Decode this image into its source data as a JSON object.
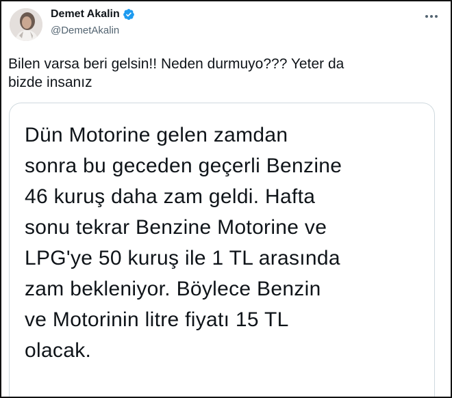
{
  "tweet": {
    "author": {
      "display_name": "Demet Akalin",
      "handle": "@DemetAkalin",
      "verified": true,
      "verified_icon": "verified-badge-icon",
      "avatar_icon": "profile-photo"
    },
    "more_icon": "more-options-icon",
    "text_line_1": "Bilen varsa beri gelsin!! Neden durmuyo??? Yeter da",
    "text_line_2": "bizde insanız",
    "embedded_card_text_lines": [
      "Dün Motorine gelen zamdan",
      "sonra bu geceden geçerli Benzine",
      "46 kuruş daha zam geldi. Hafta",
      "sonu tekrar Benzine Motorine ve",
      "LPG'ye 50 kuruş ile 1 TL arasında",
      "zam bekleniyor. Böylece Benzin",
      "ve Motorinin litre fiyatı 15 TL",
      "olacak."
    ]
  },
  "colors": {
    "text_primary": "#0f1419",
    "text_secondary": "#536471",
    "verified_blue": "#1d9bf0",
    "card_border": "#cfd9de"
  }
}
